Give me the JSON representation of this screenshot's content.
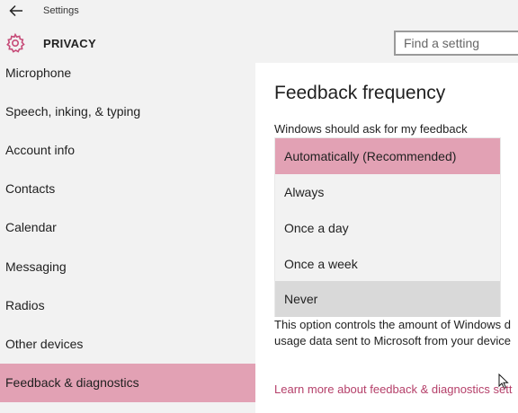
{
  "window": {
    "title": "Settings"
  },
  "header": {
    "title": "PRIVACY",
    "search_placeholder": "Find a setting"
  },
  "sidebar": {
    "items": [
      {
        "label": "Microphone",
        "selected": false
      },
      {
        "label": "Speech, inking, & typing",
        "selected": false
      },
      {
        "label": "Account info",
        "selected": false
      },
      {
        "label": "Contacts",
        "selected": false
      },
      {
        "label": "Calendar",
        "selected": false
      },
      {
        "label": "Messaging",
        "selected": false
      },
      {
        "label": "Radios",
        "selected": false
      },
      {
        "label": "Other devices",
        "selected": false
      },
      {
        "label": "Feedback & diagnostics",
        "selected": true
      }
    ]
  },
  "main": {
    "section_title": "Feedback frequency",
    "field_label": "Windows should ask for my feedback",
    "options": [
      {
        "label": "Automatically (Recommended)",
        "state": "selected"
      },
      {
        "label": "Always",
        "state": "normal"
      },
      {
        "label": "Once a day",
        "state": "normal"
      },
      {
        "label": "Once a week",
        "state": "normal"
      },
      {
        "label": "Never",
        "state": "hover"
      }
    ],
    "description_line1": "This option controls the amount of Windows d",
    "description_line2": "usage data sent to Microsoft from your device",
    "learn_more": "Learn more about feedback & diagnostics sett"
  },
  "colors": {
    "accent": "#e2a1b4",
    "link": "#b5406a",
    "sidebar_bg": "#f2f2f2",
    "hover": "#d9d9d9"
  },
  "icons": {
    "back": "back-arrow-icon",
    "settings": "gear-icon",
    "cursor": "mouse-pointer-icon"
  }
}
